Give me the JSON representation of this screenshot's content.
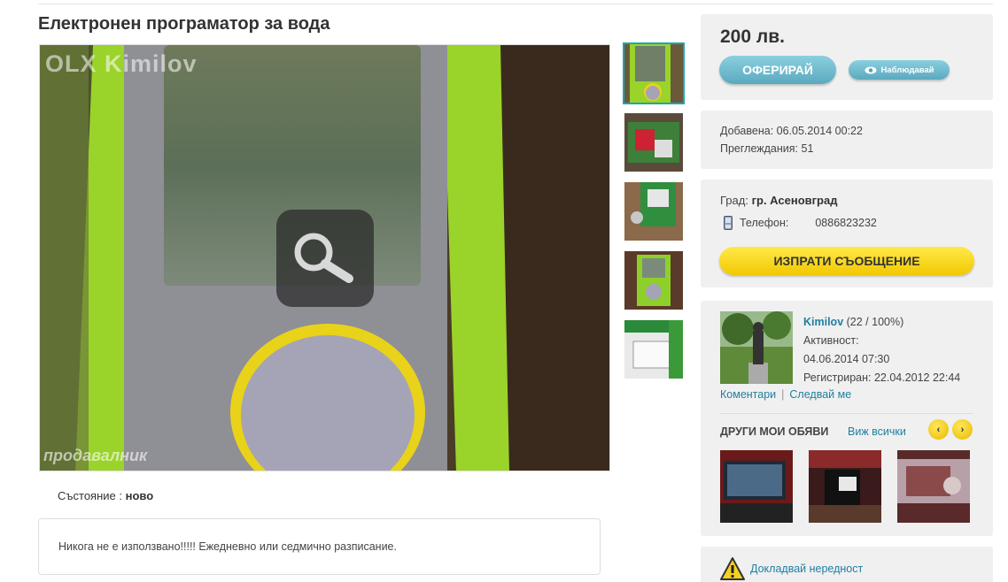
{
  "listing": {
    "title": "Електронен програматор за вода",
    "watermark_top": "OLX Kimilov",
    "watermark_bottom": "продавалник",
    "condition_label": "Състояние :",
    "condition_value": "ново",
    "description": "Никога не е използвано!!!!! Ежедневно или седмично разписание."
  },
  "gallery": {
    "zoom_icon": "magnifier-icon",
    "thumbnail_count": 5,
    "active_thumbnail": 1
  },
  "price_panel": {
    "price": "200 лв.",
    "offer_label": "ОФЕРИРАЙ",
    "watch_label": "Наблюдавай",
    "watch_icon": "eye-icon"
  },
  "stats": {
    "added": "Добавена: 06.05.2014 00:22",
    "views": "Преглеждания: 51"
  },
  "contact": {
    "city_label": "Град:",
    "city_value": "гр. Асеновград",
    "phone_icon": "mobile-phone-icon",
    "phone_label": "Телефон:",
    "phone_value": "0886823232",
    "message_button": "ИЗПРАТИ СЪОБЩЕНИЕ"
  },
  "user": {
    "name": "Kimilov",
    "rating": "(22 / 100%)",
    "activity_label": "Активност:",
    "activity_value": "04.06.2014 07:30",
    "registered": "Регистриран: 22.04.2012 22:44",
    "comments_link": "Коментари",
    "separator": "|",
    "follow_link": "Следвай ме",
    "other_ads_heading": "ДРУГИ МОИ ОБЯВИ",
    "view_all_link": "Виж всички",
    "prev_arrow": "‹",
    "next_arrow": "›"
  },
  "report": {
    "label": "Докладвай нередност",
    "icon": "warning-icon"
  },
  "colors": {
    "accent_teal": "#1aa6b7",
    "link_blue": "#1f7fa0",
    "button_yellow": "#f2c800",
    "button_blue": "#5ba9bf",
    "panel_bg": "#f0f0f0"
  }
}
